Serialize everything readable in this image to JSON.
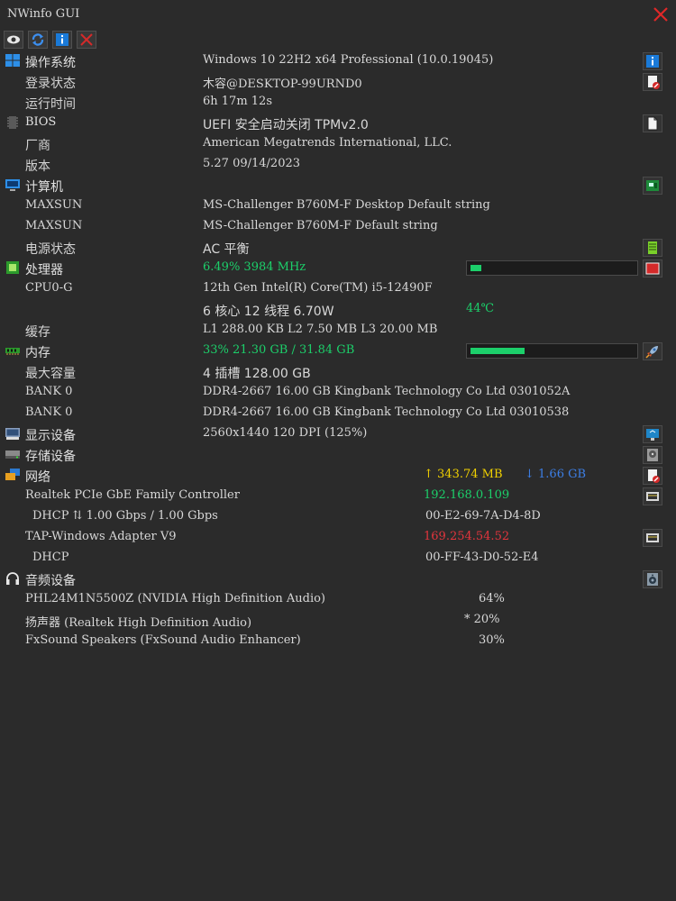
{
  "window": {
    "title": "NWinfo GUI"
  },
  "toolbar": {
    "buttons": [
      "eye-icon",
      "refresh-icon",
      "info-icon",
      "close-icon"
    ]
  },
  "os": {
    "label": "操作系统",
    "value": "Windows 10 22H2 x64 Professional (10.0.19045)",
    "login_label": "登录状态",
    "login_value": "木容@DESKTOP-99URND0",
    "uptime_label": "运行时间",
    "uptime_value": "6h 17m 12s"
  },
  "bios": {
    "label": "BIOS",
    "value": "UEFI 安全启动关闭 TPMv2.0",
    "vendor_label": "厂商",
    "vendor_value": "American Megatrends International, LLC.",
    "version_label": "版本",
    "version_value": "5.27 09/14/2023"
  },
  "computer": {
    "label": "计算机",
    "board1_label": "MAXSUN",
    "board1_value": "MS-Challenger B760M-F Desktop Default string",
    "board2_label": "MAXSUN",
    "board2_value": "MS-Challenger B760M-F Default string",
    "power_label": "电源状态",
    "power_value": "AC  平衡"
  },
  "cpu": {
    "label": "处理器",
    "usage": "6.49% 3984 MHz",
    "usage_fraction": 0.0649,
    "name_label": "CPU0-G",
    "name_value": "12th Gen Intel(R) Core(TM) i5-12490F",
    "cores": "6 核心 12 线程 6.70W",
    "temp": "44℃",
    "cache_label": "缓存",
    "cache_value": "L1 288.00 KB L2 7.50 MB L3 20.00 MB"
  },
  "memory": {
    "label": "内存",
    "usage": "33% 21.30 GB / 31.84 GB",
    "usage_fraction": 0.33,
    "max_label": "最大容量",
    "max_value": "4 插槽 128.00 GB",
    "bank1_label": "BANK 0",
    "bank1_value": "DDR4-2667 16.00 GB Kingbank Technology Co Ltd 0301052A",
    "bank2_label": "BANK 0",
    "bank2_value": "DDR4-2667 16.00 GB Kingbank Technology Co Ltd 03010538"
  },
  "display": {
    "label": "显示设备",
    "value": "2560x1440 120 DPI (125%)"
  },
  "storage": {
    "label": "存储设备"
  },
  "network": {
    "label": "网络",
    "upload": "↑ 343.74 MB",
    "download": "↓ 1.66 GB",
    "adapter1": "Realtek PCIe GbE Family Controller",
    "adapter1_ip": "192.168.0.109",
    "adapter1_detail": "DHCP  ⇅  1.00 Gbps / 1.00 Gbps",
    "adapter1_mac": "00-E2-69-7A-D4-8D",
    "adapter2": "TAP-Windows Adapter V9",
    "adapter2_ip": "169.254.54.52",
    "adapter2_detail": "DHCP",
    "adapter2_mac": "00-FF-43-D0-52-E4"
  },
  "audio": {
    "label": "音频设备",
    "devices": [
      {
        "name": "PHL24M1N5500Z (NVIDIA High Definition Audio)",
        "volume": "64%"
      },
      {
        "name": "扬声器 (Realtek High Definition Audio)",
        "volume": "* 20%"
      },
      {
        "name": "FxSound Speakers (FxSound Audio Enhancer)",
        "volume": "30%"
      }
    ]
  },
  "colors": {
    "background": "#2b2b2b",
    "accent_green": "#1ccf6a",
    "upload_yellow": "#f0d000",
    "download_blue": "#3d7fe6",
    "apipa_red": "#e2353d"
  }
}
